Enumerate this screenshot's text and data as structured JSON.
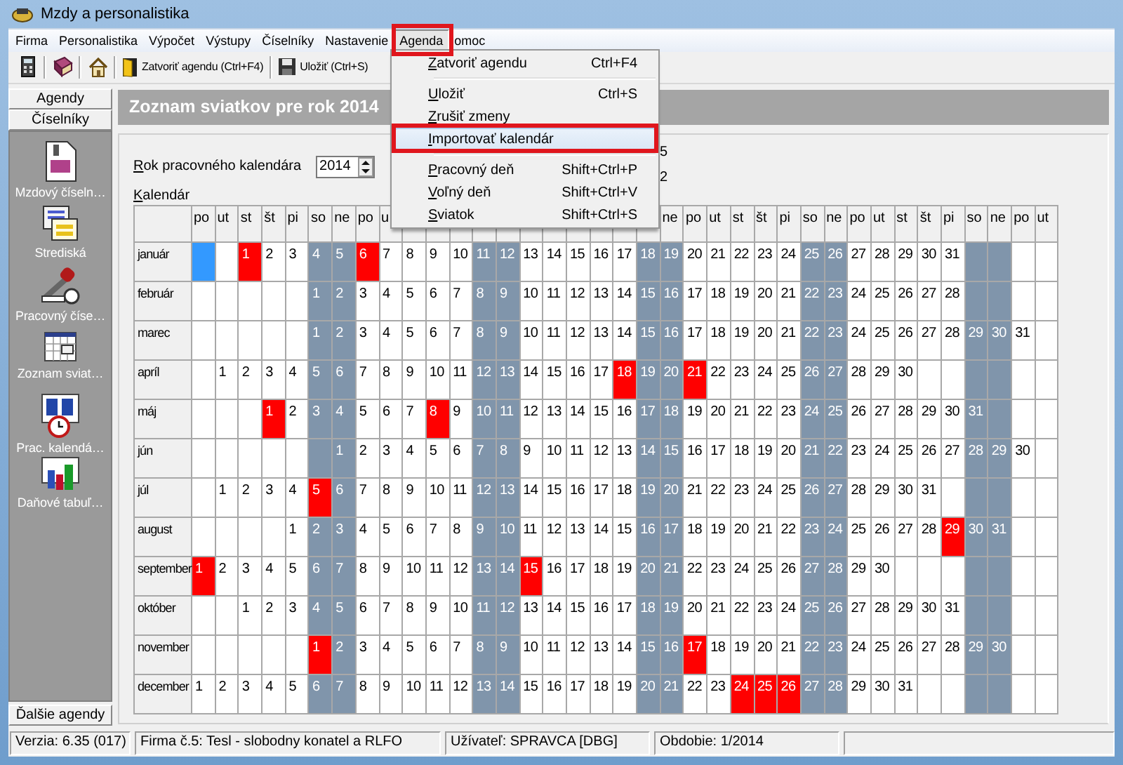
{
  "window": {
    "title": "Mzdy a personalistika"
  },
  "menu_bar": [
    {
      "label": "Firma",
      "open": false
    },
    {
      "label": "Personalistika",
      "open": false
    },
    {
      "label": "Výpočet",
      "open": false
    },
    {
      "label": "Výstupy",
      "open": false
    },
    {
      "label": "Číselníky",
      "open": false
    },
    {
      "label": "Nastavenie",
      "open": false
    },
    {
      "label": "Agenda",
      "open": true
    },
    {
      "label": "omoc",
      "open": false
    }
  ],
  "toolbar": {
    "buttons": [
      {
        "label": "Zatvoriť agendu (Ctrl+F4)"
      },
      {
        "label": "Uložiť (Ctrl+S)"
      }
    ]
  },
  "sidebar": {
    "tabs": [
      {
        "label": "Agendy"
      },
      {
        "label": "Číselníky"
      }
    ],
    "items": [
      {
        "label": "Mzdový číseln…"
      },
      {
        "label": "Strediská"
      },
      {
        "label": "Pracovný číse…"
      },
      {
        "label": "Zoznam sviat…"
      },
      {
        "label": "Prac. kalendá…"
      },
      {
        "label": "Daňové tabuľ…"
      }
    ],
    "more_button": "Ďalšie agendy"
  },
  "page": {
    "heading": "Zoznam sviatkov pre rok 2014",
    "year_label": "Rok pracovného kalendára",
    "year_value": "2014",
    "calendar_label": "Kalendár",
    "covered_fragments": [
      "5",
      "2"
    ]
  },
  "calendar": {
    "columns": [
      {
        "label": "po",
        "weekend": false
      },
      {
        "label": "ut",
        "weekend": false
      },
      {
        "label": "st",
        "weekend": false
      },
      {
        "label": "št",
        "weekend": false
      },
      {
        "label": "pi",
        "weekend": false
      },
      {
        "label": "so",
        "weekend": true
      },
      {
        "label": "ne",
        "weekend": true
      },
      {
        "label": "po",
        "weekend": false
      },
      {
        "label": "u",
        "weekend": false
      },
      {
        "weekend": false
      },
      {
        "weekend": false
      },
      {
        "weekend": false
      },
      {
        "weekend": true
      },
      {
        "weekend": true
      },
      {
        "weekend": false
      },
      {
        "weekend": false
      },
      {
        "weekend": false
      },
      {
        "weekend": false
      },
      {
        "weekend": false
      },
      {
        "weekend": true
      },
      {
        "label": "ne",
        "weekend": true
      },
      {
        "label": "po",
        "weekend": false
      },
      {
        "label": "ut",
        "weekend": false
      },
      {
        "label": "st",
        "weekend": false
      },
      {
        "label": "št",
        "weekend": false
      },
      {
        "label": "pi",
        "weekend": false
      },
      {
        "label": "so",
        "weekend": true
      },
      {
        "label": "ne",
        "weekend": true
      },
      {
        "label": "po",
        "weekend": false
      },
      {
        "label": "ut",
        "weekend": false
      },
      {
        "label": "st",
        "weekend": false
      },
      {
        "label": "št",
        "weekend": false
      },
      {
        "label": "pi",
        "weekend": false
      },
      {
        "label": "so",
        "weekend": true
      },
      {
        "label": "ne",
        "weekend": true
      },
      {
        "label": "po",
        "weekend": false
      },
      {
        "label": "ut",
        "weekend": false
      }
    ],
    "months": [
      {
        "name": "január",
        "cells": [
          {
            "kind": "cursor"
          },
          {
            "kind": "empty"
          },
          {
            "kind": "holiday",
            "text": "1"
          },
          {
            "kind": "day",
            "text": "2"
          },
          {
            "kind": "day",
            "text": "3"
          },
          {
            "kind": "day",
            "text": "4"
          },
          {
            "kind": "day",
            "text": "5"
          },
          {
            "kind": "holiday",
            "text": "6"
          },
          {
            "kind": "day",
            "text": "7"
          },
          {
            "kind": "day",
            "text": "8"
          },
          {
            "kind": "day",
            "text": "9"
          },
          {
            "kind": "day",
            "text": "10"
          },
          {
            "kind": "day",
            "text": "11"
          },
          {
            "kind": "day",
            "text": "12"
          },
          {
            "kind": "day",
            "text": "13"
          },
          {
            "kind": "day",
            "text": "14"
          },
          {
            "kind": "day",
            "text": "15"
          },
          {
            "kind": "day",
            "text": "16"
          },
          {
            "kind": "day",
            "text": "17"
          },
          {
            "kind": "day",
            "text": "18"
          },
          {
            "kind": "day",
            "text": "19"
          },
          {
            "kind": "day",
            "text": "20"
          },
          {
            "kind": "day",
            "text": "21"
          },
          {
            "kind": "day",
            "text": "22"
          },
          {
            "kind": "day",
            "text": "23"
          },
          {
            "kind": "day",
            "text": "24"
          },
          {
            "kind": "day",
            "text": "25"
          },
          {
            "kind": "day",
            "text": "26"
          },
          {
            "kind": "day",
            "text": "27"
          },
          {
            "kind": "day",
            "text": "28"
          },
          {
            "kind": "day",
            "text": "29"
          },
          {
            "kind": "day",
            "text": "30"
          },
          {
            "kind": "day",
            "text": "31"
          }
        ]
      },
      {
        "name": "február",
        "cells": [
          {
            "kind": "empty"
          },
          {
            "kind": "empty"
          },
          {
            "kind": "empty"
          },
          {
            "kind": "empty"
          },
          {
            "kind": "empty"
          },
          {
            "kind": "day",
            "text": "1"
          },
          {
            "kind": "day",
            "text": "2"
          },
          {
            "kind": "day",
            "text": "3"
          },
          {
            "kind": "day",
            "text": "4"
          },
          {
            "kind": "day",
            "text": "5"
          },
          {
            "kind": "day",
            "text": "6"
          },
          {
            "kind": "day",
            "text": "7"
          },
          {
            "kind": "day",
            "text": "8"
          },
          {
            "kind": "day",
            "text": "9"
          },
          {
            "kind": "day",
            "text": "10"
          },
          {
            "kind": "day",
            "text": "11"
          },
          {
            "kind": "day",
            "text": "12"
          },
          {
            "kind": "day",
            "text": "13"
          },
          {
            "kind": "day",
            "text": "14"
          },
          {
            "kind": "day",
            "text": "15"
          },
          {
            "kind": "day",
            "text": "16"
          },
          {
            "kind": "day",
            "text": "17"
          },
          {
            "kind": "day",
            "text": "18"
          },
          {
            "kind": "day",
            "text": "19"
          },
          {
            "kind": "day",
            "text": "20"
          },
          {
            "kind": "day",
            "text": "21"
          },
          {
            "kind": "day",
            "text": "22"
          },
          {
            "kind": "day",
            "text": "23"
          },
          {
            "kind": "day",
            "text": "24"
          },
          {
            "kind": "day",
            "text": "25"
          },
          {
            "kind": "day",
            "text": "26"
          },
          {
            "kind": "day",
            "text": "27"
          },
          {
            "kind": "day",
            "text": "28"
          }
        ]
      },
      {
        "name": "marec",
        "cells": [
          {
            "kind": "empty"
          },
          {
            "kind": "empty"
          },
          {
            "kind": "empty"
          },
          {
            "kind": "empty"
          },
          {
            "kind": "empty"
          },
          {
            "kind": "day",
            "text": "1"
          },
          {
            "kind": "day",
            "text": "2"
          },
          {
            "kind": "day",
            "text": "3"
          },
          {
            "kind": "day",
            "text": "4"
          },
          {
            "kind": "day",
            "text": "5"
          },
          {
            "kind": "day",
            "text": "6"
          },
          {
            "kind": "day",
            "text": "7"
          },
          {
            "kind": "day",
            "text": "8"
          },
          {
            "kind": "day",
            "text": "9"
          },
          {
            "kind": "day",
            "text": "10"
          },
          {
            "kind": "day",
            "text": "11"
          },
          {
            "kind": "day",
            "text": "12"
          },
          {
            "kind": "day",
            "text": "13"
          },
          {
            "kind": "day",
            "text": "14"
          },
          {
            "kind": "day",
            "text": "15"
          },
          {
            "kind": "day",
            "text": "16"
          },
          {
            "kind": "day",
            "text": "17"
          },
          {
            "kind": "day",
            "text": "18"
          },
          {
            "kind": "day",
            "text": "19"
          },
          {
            "kind": "day",
            "text": "20"
          },
          {
            "kind": "day",
            "text": "21"
          },
          {
            "kind": "day",
            "text": "22"
          },
          {
            "kind": "day",
            "text": "23"
          },
          {
            "kind": "day",
            "text": "24"
          },
          {
            "kind": "day",
            "text": "25"
          },
          {
            "kind": "day",
            "text": "26"
          },
          {
            "kind": "day",
            "text": "27"
          },
          {
            "kind": "day",
            "text": "28"
          },
          {
            "kind": "day",
            "text": "29"
          },
          {
            "kind": "day",
            "text": "30"
          },
          {
            "kind": "day",
            "text": "31"
          }
        ]
      },
      {
        "name": "apríl",
        "cells": [
          {
            "kind": "empty"
          },
          {
            "kind": "day",
            "text": "1"
          },
          {
            "kind": "day",
            "text": "2"
          },
          {
            "kind": "day",
            "text": "3"
          },
          {
            "kind": "day",
            "text": "4"
          },
          {
            "kind": "day",
            "text": "5"
          },
          {
            "kind": "day",
            "text": "6"
          },
          {
            "kind": "day",
            "text": "7"
          },
          {
            "kind": "day",
            "text": "8"
          },
          {
            "kind": "day",
            "text": "9"
          },
          {
            "kind": "day",
            "text": "10"
          },
          {
            "kind": "day",
            "text": "11"
          },
          {
            "kind": "day",
            "text": "12"
          },
          {
            "kind": "day",
            "text": "13"
          },
          {
            "kind": "day",
            "text": "14"
          },
          {
            "kind": "day",
            "text": "15"
          },
          {
            "kind": "day",
            "text": "16"
          },
          {
            "kind": "day",
            "text": "17"
          },
          {
            "kind": "holiday",
            "text": "18"
          },
          {
            "kind": "day",
            "text": "19"
          },
          {
            "kind": "day",
            "text": "20"
          },
          {
            "kind": "holiday",
            "text": "21"
          },
          {
            "kind": "day",
            "text": "22"
          },
          {
            "kind": "day",
            "text": "23"
          },
          {
            "kind": "day",
            "text": "24"
          },
          {
            "kind": "day",
            "text": "25"
          },
          {
            "kind": "day",
            "text": "26"
          },
          {
            "kind": "day",
            "text": "27"
          },
          {
            "kind": "day",
            "text": "28"
          },
          {
            "kind": "day",
            "text": "29"
          },
          {
            "kind": "day",
            "text": "30"
          }
        ]
      },
      {
        "name": "máj",
        "cells": [
          {
            "kind": "empty"
          },
          {
            "kind": "empty"
          },
          {
            "kind": "empty"
          },
          {
            "kind": "holiday",
            "text": "1"
          },
          {
            "kind": "day",
            "text": "2"
          },
          {
            "kind": "day",
            "text": "3"
          },
          {
            "kind": "day",
            "text": "4"
          },
          {
            "kind": "day",
            "text": "5"
          },
          {
            "kind": "day",
            "text": "6"
          },
          {
            "kind": "day",
            "text": "7"
          },
          {
            "kind": "holiday",
            "text": "8"
          },
          {
            "kind": "day",
            "text": "9"
          },
          {
            "kind": "day",
            "text": "10"
          },
          {
            "kind": "day",
            "text": "11"
          },
          {
            "kind": "day",
            "text": "12"
          },
          {
            "kind": "day",
            "text": "13"
          },
          {
            "kind": "day",
            "text": "14"
          },
          {
            "kind": "day",
            "text": "15"
          },
          {
            "kind": "day",
            "text": "16"
          },
          {
            "kind": "day",
            "text": "17"
          },
          {
            "kind": "day",
            "text": "18"
          },
          {
            "kind": "day",
            "text": "19"
          },
          {
            "kind": "day",
            "text": "20"
          },
          {
            "kind": "day",
            "text": "21"
          },
          {
            "kind": "day",
            "text": "22"
          },
          {
            "kind": "day",
            "text": "23"
          },
          {
            "kind": "day",
            "text": "24"
          },
          {
            "kind": "day",
            "text": "25"
          },
          {
            "kind": "day",
            "text": "26"
          },
          {
            "kind": "day",
            "text": "27"
          },
          {
            "kind": "day",
            "text": "28"
          },
          {
            "kind": "day",
            "text": "29"
          },
          {
            "kind": "day",
            "text": "30"
          },
          {
            "kind": "day",
            "text": "31"
          }
        ]
      },
      {
        "name": "jún",
        "cells": [
          {
            "kind": "empty"
          },
          {
            "kind": "empty"
          },
          {
            "kind": "empty"
          },
          {
            "kind": "empty"
          },
          {
            "kind": "empty"
          },
          {
            "kind": "empty"
          },
          {
            "kind": "day",
            "text": "1"
          },
          {
            "kind": "day",
            "text": "2"
          },
          {
            "kind": "day",
            "text": "3"
          },
          {
            "kind": "day",
            "text": "4"
          },
          {
            "kind": "day",
            "text": "5"
          },
          {
            "kind": "day",
            "text": "6"
          },
          {
            "kind": "day",
            "text": "7"
          },
          {
            "kind": "day",
            "text": "8"
          },
          {
            "kind": "day",
            "text": "9"
          },
          {
            "kind": "day",
            "text": "10"
          },
          {
            "kind": "day",
            "text": "11"
          },
          {
            "kind": "day",
            "text": "12"
          },
          {
            "kind": "day",
            "text": "13"
          },
          {
            "kind": "day",
            "text": "14"
          },
          {
            "kind": "day",
            "text": "15"
          },
          {
            "kind": "day",
            "text": "16"
          },
          {
            "kind": "day",
            "text": "17"
          },
          {
            "kind": "day",
            "text": "18"
          },
          {
            "kind": "day",
            "text": "19"
          },
          {
            "kind": "day",
            "text": "20"
          },
          {
            "kind": "day",
            "text": "21"
          },
          {
            "kind": "day",
            "text": "22"
          },
          {
            "kind": "day",
            "text": "23"
          },
          {
            "kind": "day",
            "text": "24"
          },
          {
            "kind": "day",
            "text": "25"
          },
          {
            "kind": "day",
            "text": "26"
          },
          {
            "kind": "day",
            "text": "27"
          },
          {
            "kind": "day",
            "text": "28"
          },
          {
            "kind": "day",
            "text": "29"
          },
          {
            "kind": "day",
            "text": "30"
          }
        ]
      },
      {
        "name": "júl",
        "cells": [
          {
            "kind": "empty"
          },
          {
            "kind": "day",
            "text": "1"
          },
          {
            "kind": "day",
            "text": "2"
          },
          {
            "kind": "day",
            "text": "3"
          },
          {
            "kind": "day",
            "text": "4"
          },
          {
            "kind": "holiday",
            "text": "5"
          },
          {
            "kind": "day",
            "text": "6"
          },
          {
            "kind": "day",
            "text": "7"
          },
          {
            "kind": "day",
            "text": "8"
          },
          {
            "kind": "day",
            "text": "9"
          },
          {
            "kind": "day",
            "text": "10"
          },
          {
            "kind": "day",
            "text": "11"
          },
          {
            "kind": "day",
            "text": "12"
          },
          {
            "kind": "day",
            "text": "13"
          },
          {
            "kind": "day",
            "text": "14"
          },
          {
            "kind": "day",
            "text": "15"
          },
          {
            "kind": "day",
            "text": "16"
          },
          {
            "kind": "day",
            "text": "17"
          },
          {
            "kind": "day",
            "text": "18"
          },
          {
            "kind": "day",
            "text": "19"
          },
          {
            "kind": "day",
            "text": "20"
          },
          {
            "kind": "day",
            "text": "21"
          },
          {
            "kind": "day",
            "text": "22"
          },
          {
            "kind": "day",
            "text": "23"
          },
          {
            "kind": "day",
            "text": "24"
          },
          {
            "kind": "day",
            "text": "25"
          },
          {
            "kind": "day",
            "text": "26"
          },
          {
            "kind": "day",
            "text": "27"
          },
          {
            "kind": "day",
            "text": "28"
          },
          {
            "kind": "day",
            "text": "29"
          },
          {
            "kind": "day",
            "text": "30"
          },
          {
            "kind": "day",
            "text": "31"
          }
        ]
      },
      {
        "name": "august",
        "cells": [
          {
            "kind": "empty"
          },
          {
            "kind": "empty"
          },
          {
            "kind": "empty"
          },
          {
            "kind": "empty"
          },
          {
            "kind": "day",
            "text": "1"
          },
          {
            "kind": "day",
            "text": "2"
          },
          {
            "kind": "day",
            "text": "3"
          },
          {
            "kind": "day",
            "text": "4"
          },
          {
            "kind": "day",
            "text": "5"
          },
          {
            "kind": "day",
            "text": "6"
          },
          {
            "kind": "day",
            "text": "7"
          },
          {
            "kind": "day",
            "text": "8"
          },
          {
            "kind": "day",
            "text": "9"
          },
          {
            "kind": "day",
            "text": "10"
          },
          {
            "kind": "day",
            "text": "11"
          },
          {
            "kind": "day",
            "text": "12"
          },
          {
            "kind": "day",
            "text": "13"
          },
          {
            "kind": "day",
            "text": "14"
          },
          {
            "kind": "day",
            "text": "15"
          },
          {
            "kind": "day",
            "text": "16"
          },
          {
            "kind": "day",
            "text": "17"
          },
          {
            "kind": "day",
            "text": "18"
          },
          {
            "kind": "day",
            "text": "19"
          },
          {
            "kind": "day",
            "text": "20"
          },
          {
            "kind": "day",
            "text": "21"
          },
          {
            "kind": "day",
            "text": "22"
          },
          {
            "kind": "day",
            "text": "23"
          },
          {
            "kind": "day",
            "text": "24"
          },
          {
            "kind": "day",
            "text": "25"
          },
          {
            "kind": "day",
            "text": "26"
          },
          {
            "kind": "day",
            "text": "27"
          },
          {
            "kind": "day",
            "text": "28"
          },
          {
            "kind": "holiday",
            "text": "29"
          },
          {
            "kind": "day",
            "text": "30"
          },
          {
            "kind": "day",
            "text": "31"
          }
        ]
      },
      {
        "name": "september",
        "cells": [
          {
            "kind": "holiday",
            "text": "1"
          },
          {
            "kind": "day",
            "text": "2"
          },
          {
            "kind": "day",
            "text": "3"
          },
          {
            "kind": "day",
            "text": "4"
          },
          {
            "kind": "day",
            "text": "5"
          },
          {
            "kind": "day",
            "text": "6"
          },
          {
            "kind": "day",
            "text": "7"
          },
          {
            "kind": "day",
            "text": "8"
          },
          {
            "kind": "day",
            "text": "9"
          },
          {
            "kind": "day",
            "text": "10"
          },
          {
            "kind": "day",
            "text": "11"
          },
          {
            "kind": "day",
            "text": "12"
          },
          {
            "kind": "day",
            "text": "13"
          },
          {
            "kind": "day",
            "text": "14"
          },
          {
            "kind": "holiday",
            "text": "15"
          },
          {
            "kind": "day",
            "text": "16"
          },
          {
            "kind": "day",
            "text": "17"
          },
          {
            "kind": "day",
            "text": "18"
          },
          {
            "kind": "day",
            "text": "19"
          },
          {
            "kind": "day",
            "text": "20"
          },
          {
            "kind": "day",
            "text": "21"
          },
          {
            "kind": "day",
            "text": "22"
          },
          {
            "kind": "day",
            "text": "23"
          },
          {
            "kind": "day",
            "text": "24"
          },
          {
            "kind": "day",
            "text": "25"
          },
          {
            "kind": "day",
            "text": "26"
          },
          {
            "kind": "day",
            "text": "27"
          },
          {
            "kind": "day",
            "text": "28"
          },
          {
            "kind": "day",
            "text": "29"
          },
          {
            "kind": "day",
            "text": "30"
          }
        ]
      },
      {
        "name": "október",
        "cells": [
          {
            "kind": "empty"
          },
          {
            "kind": "empty"
          },
          {
            "kind": "day",
            "text": "1"
          },
          {
            "kind": "day",
            "text": "2"
          },
          {
            "kind": "day",
            "text": "3"
          },
          {
            "kind": "day",
            "text": "4"
          },
          {
            "kind": "day",
            "text": "5"
          },
          {
            "kind": "day",
            "text": "6"
          },
          {
            "kind": "day",
            "text": "7"
          },
          {
            "kind": "day",
            "text": "8"
          },
          {
            "kind": "day",
            "text": "9"
          },
          {
            "kind": "day",
            "text": "10"
          },
          {
            "kind": "day",
            "text": "11"
          },
          {
            "kind": "day",
            "text": "12"
          },
          {
            "kind": "day",
            "text": "13"
          },
          {
            "kind": "day",
            "text": "14"
          },
          {
            "kind": "day",
            "text": "15"
          },
          {
            "kind": "day",
            "text": "16"
          },
          {
            "kind": "day",
            "text": "17"
          },
          {
            "kind": "day",
            "text": "18"
          },
          {
            "kind": "day",
            "text": "19"
          },
          {
            "kind": "day",
            "text": "20"
          },
          {
            "kind": "day",
            "text": "21"
          },
          {
            "kind": "day",
            "text": "22"
          },
          {
            "kind": "day",
            "text": "23"
          },
          {
            "kind": "day",
            "text": "24"
          },
          {
            "kind": "day",
            "text": "25"
          },
          {
            "kind": "day",
            "text": "26"
          },
          {
            "kind": "day",
            "text": "27"
          },
          {
            "kind": "day",
            "text": "28"
          },
          {
            "kind": "day",
            "text": "29"
          },
          {
            "kind": "day",
            "text": "30"
          },
          {
            "kind": "day",
            "text": "31"
          }
        ]
      },
      {
        "name": "november",
        "cells": [
          {
            "kind": "empty"
          },
          {
            "kind": "empty"
          },
          {
            "kind": "empty"
          },
          {
            "kind": "empty"
          },
          {
            "kind": "empty"
          },
          {
            "kind": "holiday",
            "text": "1"
          },
          {
            "kind": "day",
            "text": "2"
          },
          {
            "kind": "day",
            "text": "3"
          },
          {
            "kind": "day",
            "text": "4"
          },
          {
            "kind": "day",
            "text": "5"
          },
          {
            "kind": "day",
            "text": "6"
          },
          {
            "kind": "day",
            "text": "7"
          },
          {
            "kind": "day",
            "text": "8"
          },
          {
            "kind": "day",
            "text": "9"
          },
          {
            "kind": "day",
            "text": "10"
          },
          {
            "kind": "day",
            "text": "11"
          },
          {
            "kind": "day",
            "text": "12"
          },
          {
            "kind": "day",
            "text": "13"
          },
          {
            "kind": "day",
            "text": "14"
          },
          {
            "kind": "day",
            "text": "15"
          },
          {
            "kind": "day",
            "text": "16"
          },
          {
            "kind": "holiday",
            "text": "17"
          },
          {
            "kind": "day",
            "text": "18"
          },
          {
            "kind": "day",
            "text": "19"
          },
          {
            "kind": "day",
            "text": "20"
          },
          {
            "kind": "day",
            "text": "21"
          },
          {
            "kind": "day",
            "text": "22"
          },
          {
            "kind": "day",
            "text": "23"
          },
          {
            "kind": "day",
            "text": "24"
          },
          {
            "kind": "day",
            "text": "25"
          },
          {
            "kind": "day",
            "text": "26"
          },
          {
            "kind": "day",
            "text": "27"
          },
          {
            "kind": "day",
            "text": "28"
          },
          {
            "kind": "day",
            "text": "29"
          },
          {
            "kind": "day",
            "text": "30"
          }
        ]
      },
      {
        "name": "december",
        "cells": [
          {
            "kind": "day",
            "text": "1"
          },
          {
            "kind": "day",
            "text": "2"
          },
          {
            "kind": "day",
            "text": "3"
          },
          {
            "kind": "day",
            "text": "4"
          },
          {
            "kind": "day",
            "text": "5"
          },
          {
            "kind": "day",
            "text": "6"
          },
          {
            "kind": "day",
            "text": "7"
          },
          {
            "kind": "day",
            "text": "8"
          },
          {
            "kind": "day",
            "text": "9"
          },
          {
            "kind": "day",
            "text": "10"
          },
          {
            "kind": "day",
            "text": "11"
          },
          {
            "kind": "day",
            "text": "12"
          },
          {
            "kind": "day",
            "text": "13"
          },
          {
            "kind": "day",
            "text": "14"
          },
          {
            "kind": "day",
            "text": "15"
          },
          {
            "kind": "day",
            "text": "16"
          },
          {
            "kind": "day",
            "text": "17"
          },
          {
            "kind": "day",
            "text": "18"
          },
          {
            "kind": "day",
            "text": "19"
          },
          {
            "kind": "day",
            "text": "20"
          },
          {
            "kind": "day",
            "text": "21"
          },
          {
            "kind": "day",
            "text": "22"
          },
          {
            "kind": "day",
            "text": "23"
          },
          {
            "kind": "holiday",
            "text": "24"
          },
          {
            "kind": "holiday",
            "text": "25"
          },
          {
            "kind": "holiday",
            "text": "26"
          },
          {
            "kind": "day",
            "text": "27"
          },
          {
            "kind": "day",
            "text": "28"
          },
          {
            "kind": "day",
            "text": "29"
          },
          {
            "kind": "day",
            "text": "30"
          },
          {
            "kind": "day",
            "text": "31"
          }
        ]
      }
    ]
  },
  "agenda_menu": [
    {
      "kind": "item",
      "label": "Zatvoriť agendu",
      "shortcut": "Ctrl+F4",
      "selected": false
    },
    {
      "kind": "separator"
    },
    {
      "kind": "item",
      "label": "Uložiť",
      "shortcut": "Ctrl+S",
      "selected": false
    },
    {
      "kind": "item",
      "label": "Zrušiť zmeny",
      "selected": false
    },
    {
      "kind": "item",
      "label": "Importovať kalendár",
      "selected": true
    },
    {
      "kind": "separator"
    },
    {
      "kind": "item",
      "label": "Pracovný deň",
      "shortcut": "Shift+Ctrl+P",
      "selected": false
    },
    {
      "kind": "item",
      "label": "Voľný deň",
      "shortcut": "Shift+Ctrl+V",
      "selected": false
    },
    {
      "kind": "item",
      "label": "Sviatok",
      "shortcut": "Shift+Ctrl+S",
      "selected": false
    }
  ],
  "status_bar": [
    "Verzia: 6.35 (017)",
    "Firma č.5: Tesl - slobodny konatel a RLFO",
    "Užívateľ: SPRAVCA [DBG]",
    "Obdobie: 1/2014"
  ]
}
